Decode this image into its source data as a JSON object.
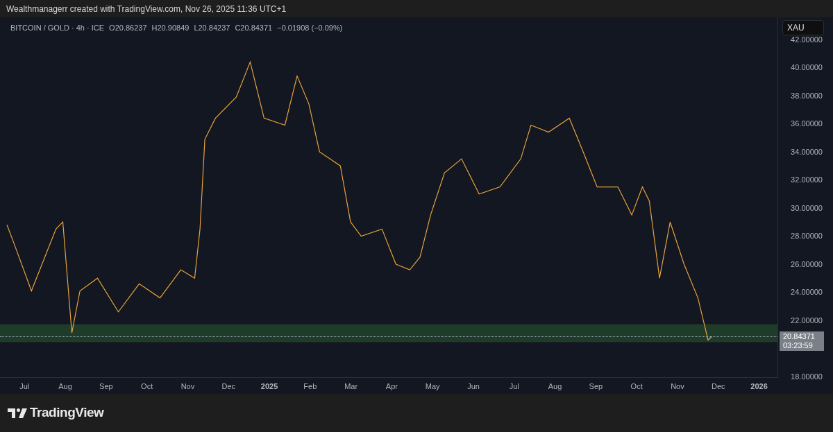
{
  "header": {
    "caption": "Wealthmanagerr created with TradingView.com, Nov 26, 2025 11:36 UTC+1"
  },
  "chart": {
    "legend": {
      "symbol": "BITCOIN / GOLD · 4h · ICE",
      "open_label": "O",
      "open": "20.86237",
      "high_label": "H",
      "high": "20.90849",
      "low_label": "L",
      "low": "20.84237",
      "close_label": "C",
      "close": "20.84371",
      "change": "−0.01908 (−0.09%)"
    },
    "currency_badge": "XAU",
    "price_label": {
      "price": "20.84371",
      "countdown": "03:23:59"
    },
    "chart_data": {
      "type": "line",
      "xlim": [
        2024.45,
        2026.0375
      ],
      "ylim": [
        17.9,
        43.58
      ],
      "xticks": [
        {
          "value": 2024.5,
          "label": "Jul"
        },
        {
          "value": 2024.5833,
          "label": "Aug"
        },
        {
          "value": 2024.6667,
          "label": "Sep"
        },
        {
          "value": 2024.75,
          "label": "Oct"
        },
        {
          "value": 2024.8333,
          "label": "Nov"
        },
        {
          "value": 2024.9167,
          "label": "Dec"
        },
        {
          "value": 2025,
          "label": "2025"
        },
        {
          "value": 2025.0833,
          "label": "Feb"
        },
        {
          "value": 2025.1667,
          "label": "Mar"
        },
        {
          "value": 2025.25,
          "label": "Apr"
        },
        {
          "value": 2025.3333,
          "label": "May"
        },
        {
          "value": 2025.4167,
          "label": "Jun"
        },
        {
          "value": 2025.5,
          "label": "Jul"
        },
        {
          "value": 2025.5833,
          "label": "Aug"
        },
        {
          "value": 2025.6667,
          "label": "Sep"
        },
        {
          "value": 2025.75,
          "label": "Oct"
        },
        {
          "value": 2025.8333,
          "label": "Nov"
        },
        {
          "value": 2025.9167,
          "label": "Dec"
        },
        {
          "value": 2026,
          "label": "2026"
        }
      ],
      "yticks": [
        {
          "value": 18,
          "label": "18.00000"
        },
        {
          "value": 22,
          "label": "22.00000"
        },
        {
          "value": 24,
          "label": "24.00000"
        },
        {
          "value": 26,
          "label": "26.00000"
        },
        {
          "value": 28,
          "label": "28.00000"
        },
        {
          "value": 30,
          "label": "30.00000"
        },
        {
          "value": 32,
          "label": "32.00000"
        },
        {
          "value": 34,
          "label": "34.00000"
        },
        {
          "value": 36,
          "label": "36.00000"
        },
        {
          "value": 38,
          "label": "38.00000"
        },
        {
          "value": 40,
          "label": "40.00000"
        },
        {
          "value": 42,
          "label": "42.00000"
        }
      ],
      "x": [
        2024.4642,
        2024.4783,
        2024.5142,
        2024.5358,
        2024.5642,
        2024.5783,
        2024.5967,
        2024.6133,
        2024.6492,
        2024.6917,
        2024.7342,
        2024.7767,
        2024.8192,
        2024.8475,
        2024.8583,
        2024.8683,
        2024.89,
        2024.9325,
        2024.9608,
        2024.9892,
        2025.0317,
        2025.0567,
        2025.0808,
        2025.1025,
        2025.145,
        2025.1658,
        2025.1875,
        2025.23,
        2025.2583,
        2025.2867,
        2025.3075,
        2025.3292,
        2025.3575,
        2025.3925,
        2025.4283,
        2025.4708,
        2025.5133,
        2025.5342,
        2025.57,
        2025.6125,
        2025.6408,
        2025.6692,
        2025.7117,
        2025.74,
        2025.7617,
        2025.7758,
        2025.7967,
        2025.8183,
        2025.8467,
        2025.875,
        2025.8958,
        2025.9033
      ],
      "series": [
        {
          "color": "#e8a33c",
          "values": [
            28.8,
            27.5,
            24.1,
            26,
            28.5,
            29,
            21.1,
            24.1,
            25,
            22.6,
            24.6,
            23.6,
            25.6,
            25,
            28.5,
            34.9,
            36.4,
            37.9,
            40.4,
            36.4,
            35.9,
            39.4,
            37.4,
            34,
            33,
            29,
            28,
            28.5,
            26,
            25.6,
            26.5,
            29.5,
            32.5,
            33.5,
            31,
            31.5,
            33.5,
            35.9,
            35.4,
            36.4,
            34,
            31.5,
            31.5,
            29.5,
            31.5,
            30.5,
            25,
            29,
            26,
            23.6,
            20.6,
            20.84
          ]
        }
      ]
    }
  },
  "footer": {
    "logo_text": "TradingView"
  }
}
